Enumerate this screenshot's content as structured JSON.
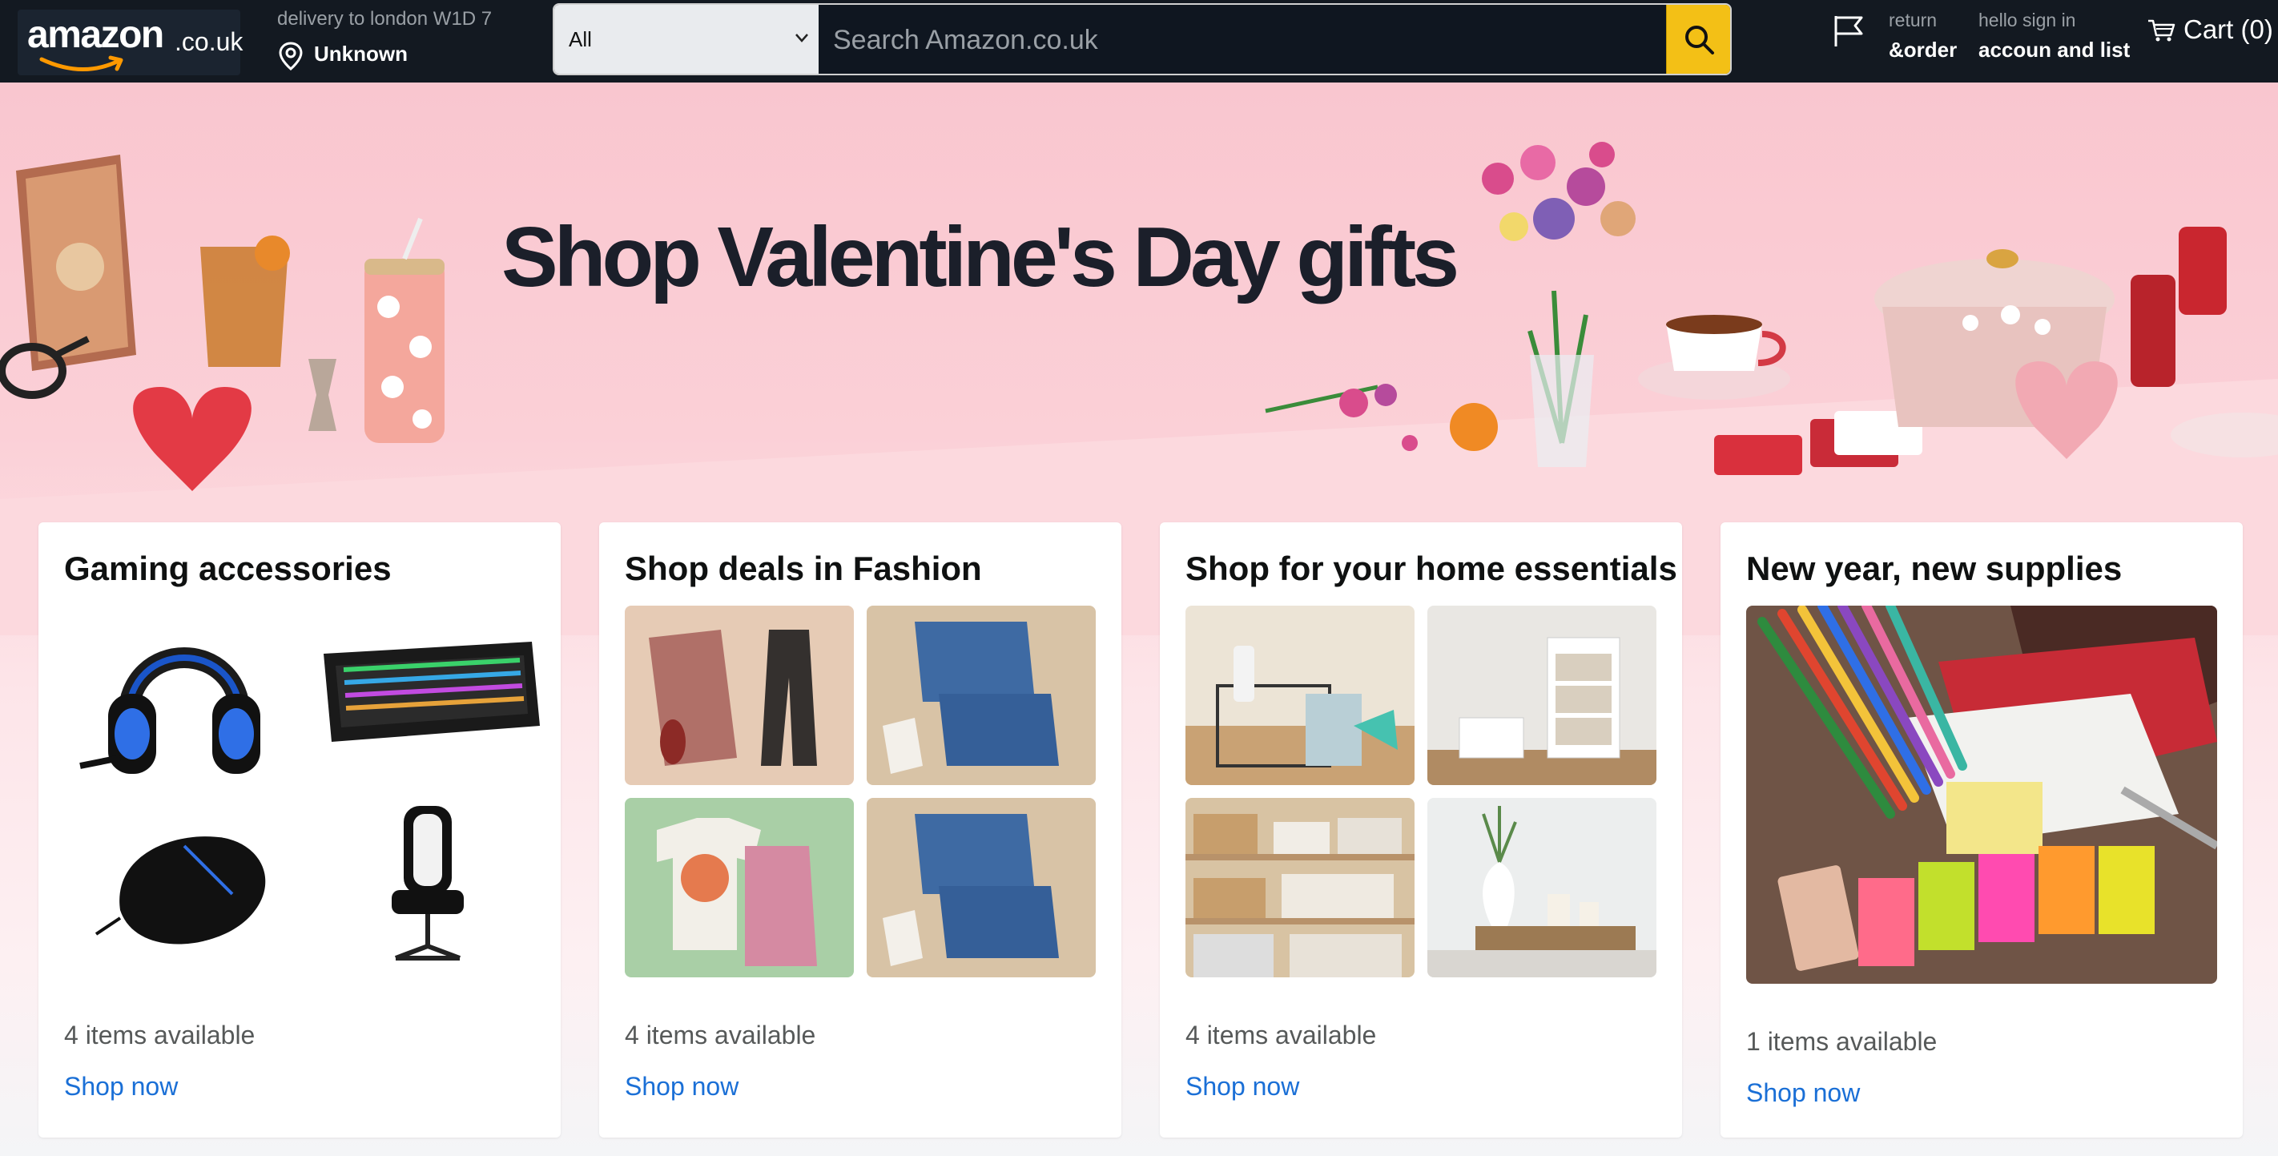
{
  "header": {
    "logo_word": "amazon",
    "logo_tld": ".co.uk",
    "deliver_line1": "delivery to london W1D 7",
    "deliver_line2": "Unknown",
    "search_category": "All",
    "search_placeholder": "Search Amazon.co.uk",
    "returns_line1": "return",
    "returns_line2": "&order",
    "account_line1": "hello sign in",
    "account_line2": "accoun and list",
    "cart_label": "Cart (0)"
  },
  "hero": {
    "title": "Shop Valentine's Day gifts"
  },
  "cards": [
    {
      "title": "Gaming accessories",
      "count": "4 items available",
      "link": "Shop now"
    },
    {
      "title": "Shop deals in Fashion",
      "count": "4 items available",
      "link": "Shop now"
    },
    {
      "title": "Shop for your home essentials",
      "count": "4 items available",
      "link": "Shop now"
    },
    {
      "title": "New year, new supplies",
      "count": "1 items available",
      "link": "Shop now"
    }
  ],
  "colors": {
    "header_bg": "#131921",
    "search_button": "#f3c016",
    "link": "#1a6fd6",
    "hero_bg": "#f9c6cf"
  },
  "icons": [
    "location-pin-icon",
    "search-icon",
    "chevron-down-icon",
    "flag-icon",
    "cart-icon"
  ]
}
